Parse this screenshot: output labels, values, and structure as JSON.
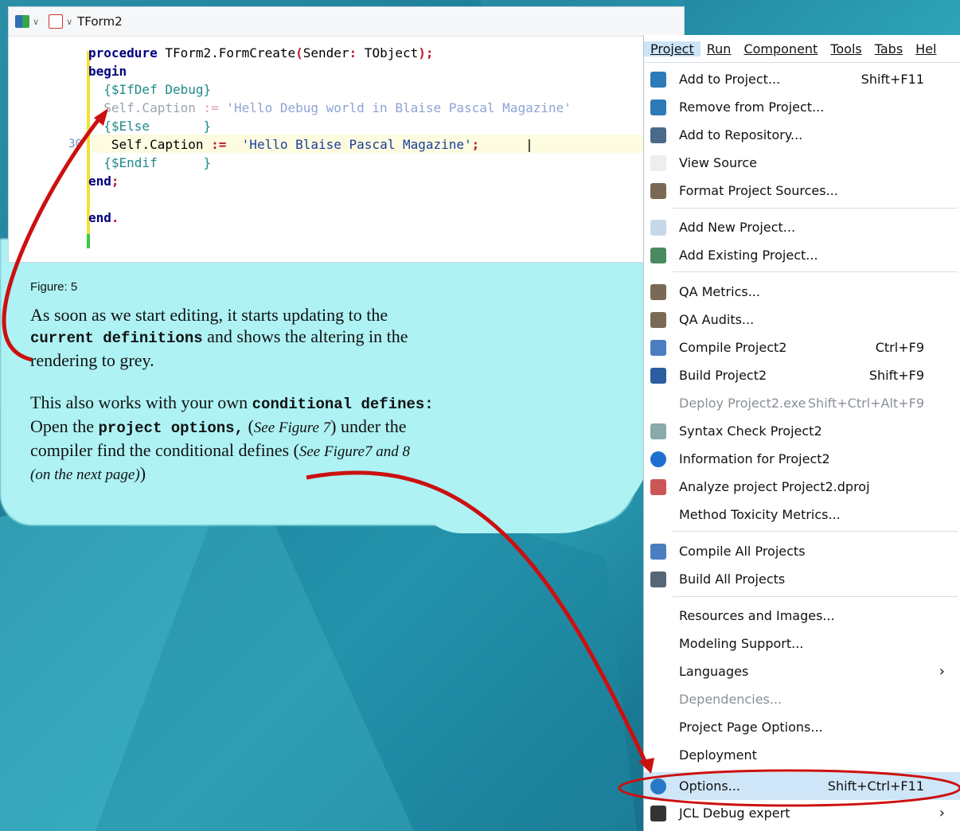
{
  "toolbar": {
    "title": "TForm2"
  },
  "code": {
    "line_number": "30",
    "l1_kw": "procedure",
    "l1_rest": " TForm2.FormCreate",
    "l1_p1": "(",
    "l1_mid": "Sender",
    "l1_colon": ":",
    "l1_type": " TObject",
    "l1_end": ");",
    "l2": "begin",
    "l3": "{$IfDef Debug}",
    "l4_a": "Self",
    "l4_b": ".Caption ",
    "l4_op": ":=",
    "l4_str": " 'Hello Debug world in Blaise Pascal Magazine'",
    "l5": "{$Else       }",
    "l6_a": "Self",
    "l6_b": ".Caption ",
    "l6_op": ":=",
    "l6_str": "  'Hello Blaise Pascal Magazine'",
    "l6_end": ";",
    "l7": "{$Endif      }",
    "l8": "end",
    "l8_end": ";",
    "l9": "end",
    "l9_end": "."
  },
  "figure_label": "Figure: 5",
  "p1": {
    "a": "As soon as we start editing, it starts updating to the",
    "b_mono": "current definitions",
    "c": " and shows the altering in the",
    "d": "rendering  to grey."
  },
  "p2": {
    "a": "This also works with your own ",
    "a_mono": "conditional defines:",
    "b": "Open the ",
    "b_mono": "project options,",
    "c": " (",
    "c_it": "See Figure 7",
    "d": ") under the",
    "e": "compiler find the conditional defines (",
    "e_it": "See Figure7 and 8",
    "f_it": "(on the next page)",
    "f": ")"
  },
  "menubar": [
    "Project",
    "Run",
    "Component",
    "Tools",
    "Tabs",
    "Hel"
  ],
  "menu": [
    {
      "label": "Add to Project...",
      "shortcut": "Shift+F11",
      "icon": "add-to-project-icon"
    },
    {
      "label": "Remove from Project...",
      "shortcut": "",
      "icon": "remove-from-project-icon"
    },
    {
      "label": "Add to Repository...",
      "shortcut": "",
      "icon": "repository-icon"
    },
    {
      "label": "View Source",
      "shortcut": "",
      "icon": "document-icon"
    },
    {
      "label": "Format Project Sources...",
      "shortcut": "",
      "icon": "format-icon"
    },
    {
      "label": "Add New Project...",
      "shortcut": "",
      "icon": "new-project-icon"
    },
    {
      "label": "Add Existing Project...",
      "shortcut": "",
      "icon": "existing-project-icon"
    },
    {
      "label": "QA Metrics...",
      "shortcut": "",
      "icon": "qa-metrics-icon"
    },
    {
      "label": "QA Audits...",
      "shortcut": "",
      "icon": "qa-audits-icon"
    },
    {
      "label": "Compile Project2",
      "shortcut": "Ctrl+F9",
      "icon": "compile-icon"
    },
    {
      "label": "Build Project2",
      "shortcut": "Shift+F9",
      "icon": "build-icon"
    },
    {
      "label": "Deploy Project2.exe",
      "shortcut": "Shift+Ctrl+Alt+F9",
      "icon": "",
      "disabled": true
    },
    {
      "label": "Syntax Check Project2",
      "shortcut": "",
      "icon": "syntax-check-icon"
    },
    {
      "label": "Information for Project2",
      "shortcut": "",
      "icon": "info-icon"
    },
    {
      "label": "Analyze project Project2.dproj",
      "shortcut": "",
      "icon": "analyze-icon"
    },
    {
      "label": "Method Toxicity Metrics...",
      "shortcut": "",
      "icon": ""
    },
    {
      "label": "Compile All Projects",
      "shortcut": "",
      "icon": "compile-all-icon"
    },
    {
      "label": "Build All Projects",
      "shortcut": "",
      "icon": "build-all-icon"
    },
    {
      "label": "Resources and Images...",
      "shortcut": "",
      "icon": ""
    },
    {
      "label": "Modeling Support...",
      "shortcut": "",
      "icon": ""
    },
    {
      "label": "Languages",
      "shortcut": "",
      "icon": "",
      "submenu": true
    },
    {
      "label": "Dependencies...",
      "shortcut": "",
      "icon": "",
      "disabled": true
    },
    {
      "label": "Project Page Options...",
      "shortcut": "",
      "icon": ""
    },
    {
      "label": "Deployment",
      "shortcut": "",
      "icon": ""
    },
    {
      "label": "Options...",
      "shortcut": "Shift+Ctrl+F11",
      "icon": "options-gear-icon",
      "selected": true
    },
    {
      "label": "JCL Debug expert",
      "shortcut": "",
      "icon": "jcl-icon",
      "submenu": true
    }
  ],
  "colors": {
    "accent": "#cc1010",
    "menu_select": "#cfe6f8",
    "cloud": "#aef2f4"
  }
}
